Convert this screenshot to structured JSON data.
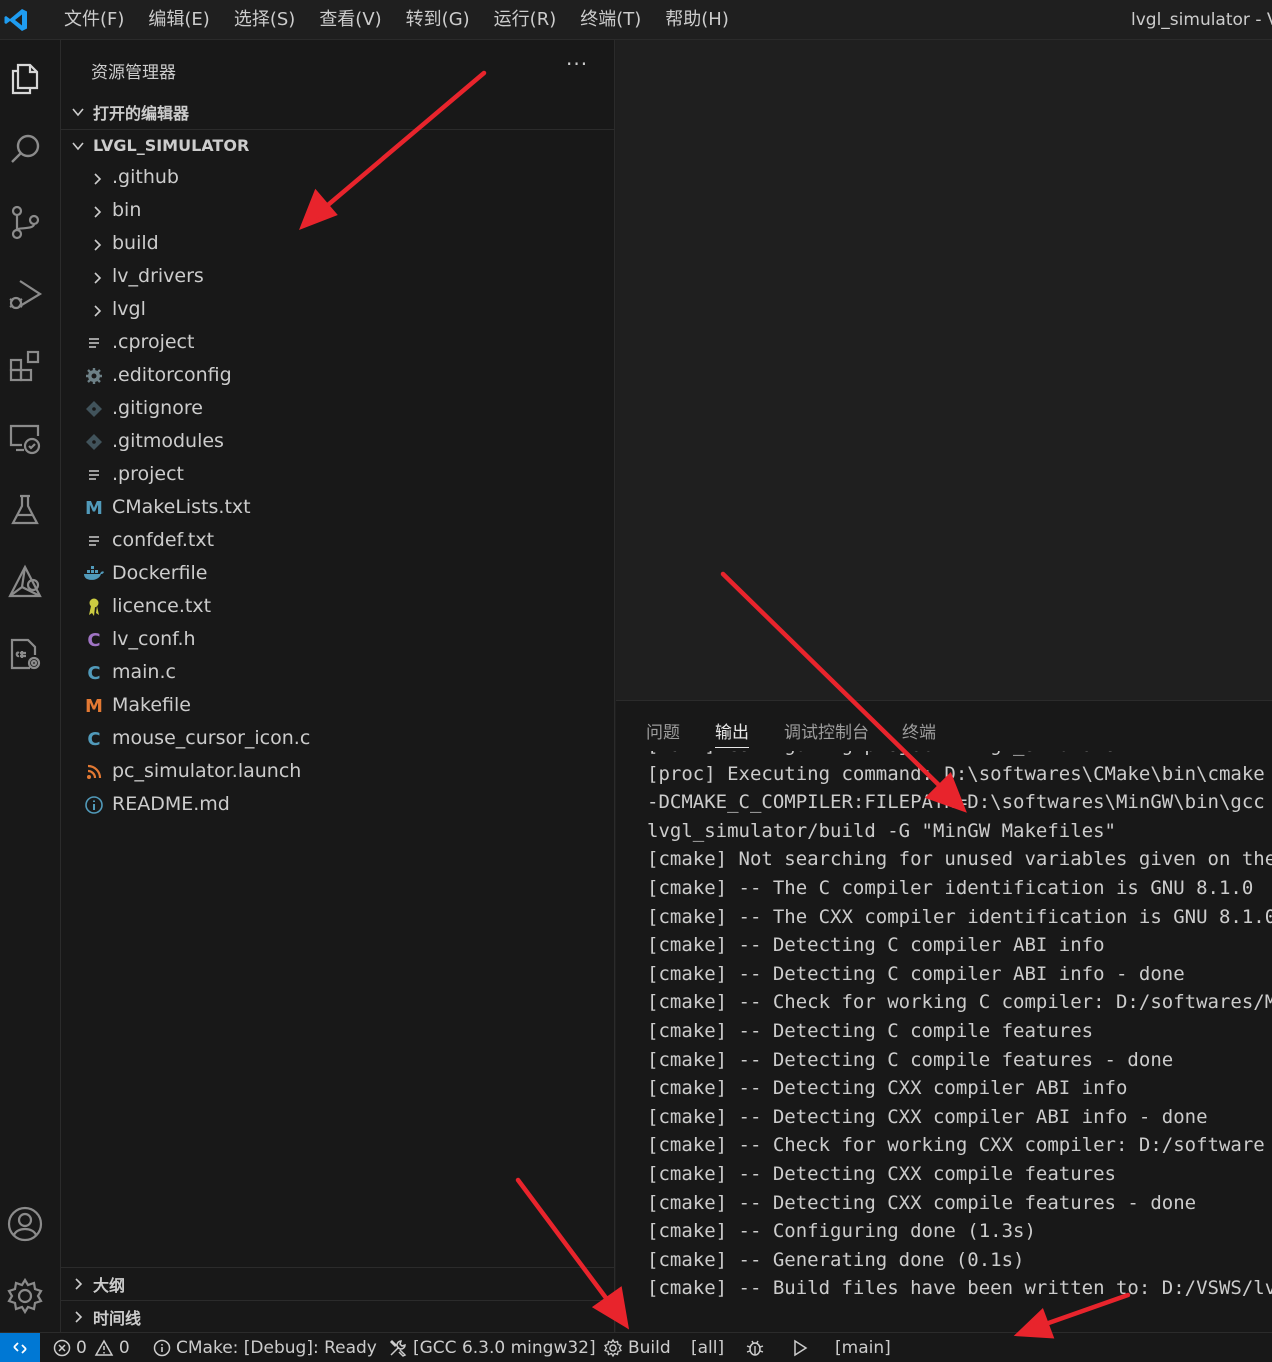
{
  "menubar": {
    "items": [
      "文件(F)",
      "编辑(E)",
      "选择(S)",
      "查看(V)",
      "转到(G)",
      "运行(R)",
      "终端(T)",
      "帮助(H)"
    ],
    "window_title": "lvgl_simulator - Vi"
  },
  "activitybar": {
    "icons": [
      "explorer-icon",
      "search-icon",
      "source-control-icon",
      "run-debug-icon",
      "extensions-icon",
      "remote-explorer-icon",
      "testing-icon",
      "cmake-icon",
      "makefile-tools-icon",
      "accounts-icon",
      "settings-gear-icon"
    ]
  },
  "sidebar": {
    "title": "资源管理器",
    "more": "···",
    "open_editors": "打开的编辑器",
    "project": "LVGL_SIMULATOR",
    "tree": [
      {
        "name": ".github",
        "type": "folder"
      },
      {
        "name": "bin",
        "type": "folder"
      },
      {
        "name": "build",
        "type": "folder"
      },
      {
        "name": "lv_drivers",
        "type": "folder"
      },
      {
        "name": "lvgl",
        "type": "folder"
      },
      {
        "name": ".cproject",
        "type": "text"
      },
      {
        "name": ".editorconfig",
        "type": "gear"
      },
      {
        "name": ".gitignore",
        "type": "git"
      },
      {
        "name": ".gitmodules",
        "type": "git"
      },
      {
        "name": ".project",
        "type": "text"
      },
      {
        "name": "CMakeLists.txt",
        "type": "m-blue"
      },
      {
        "name": "confdef.txt",
        "type": "text"
      },
      {
        "name": "Dockerfile",
        "type": "docker"
      },
      {
        "name": "licence.txt",
        "type": "licence"
      },
      {
        "name": "lv_conf.h",
        "type": "c-purple"
      },
      {
        "name": "main.c",
        "type": "c-blue"
      },
      {
        "name": "Makefile",
        "type": "m-orange"
      },
      {
        "name": "mouse_cursor_icon.c",
        "type": "c-blue"
      },
      {
        "name": "pc_simulator.launch",
        "type": "rss"
      },
      {
        "name": "README.md",
        "type": "info"
      }
    ],
    "outline": "大纲",
    "timeline": "时间线"
  },
  "panel": {
    "tabs": [
      "问题",
      "输出",
      "调试控制台",
      "终端"
    ],
    "active_tab": "输出",
    "output": [
      "[main] Configuring project: lvgl_simulator",
      "[proc] Executing command: D:\\softwares\\CMake\\bin\\cmake",
      "-DCMAKE_C_COMPILER:FILEPATH=D:\\softwares\\MinGW\\bin\\gcc",
      "lvgl_simulator/build -G \"MinGW Makefiles\"",
      "[cmake] Not searching for unused variables given on the",
      "[cmake] -- The C compiler identification is GNU 8.1.0",
      "[cmake] -- The CXX compiler identification is GNU 8.1.0",
      "[cmake] -- Detecting C compiler ABI info",
      "[cmake] -- Detecting C compiler ABI info - done",
      "[cmake] -- Check for working C compiler: D:/softwares/M",
      "[cmake] -- Detecting C compile features",
      "[cmake] -- Detecting C compile features - done",
      "[cmake] -- Detecting CXX compiler ABI info",
      "[cmake] -- Detecting CXX compiler ABI info - done",
      "[cmake] -- Check for working CXX compiler: D:/software",
      "[cmake] -- Detecting CXX compile features",
      "[cmake] -- Detecting CXX compile features - done",
      "[cmake] -- Configuring done (1.3s)",
      "[cmake] -- Generating done (0.1s)",
      "[cmake] -- Build files have been written to: D:/VSWS/lv"
    ]
  },
  "statusbar": {
    "errors": "0",
    "warnings": "0",
    "cmake_status": "CMake: [Debug]: Ready",
    "kit": "[GCC 6.3.0 mingw32]",
    "build": "Build",
    "target": "[all]",
    "launch_target": "[main]"
  },
  "colors": {
    "accent": "#0078d4",
    "arrow": "#e8242c"
  }
}
